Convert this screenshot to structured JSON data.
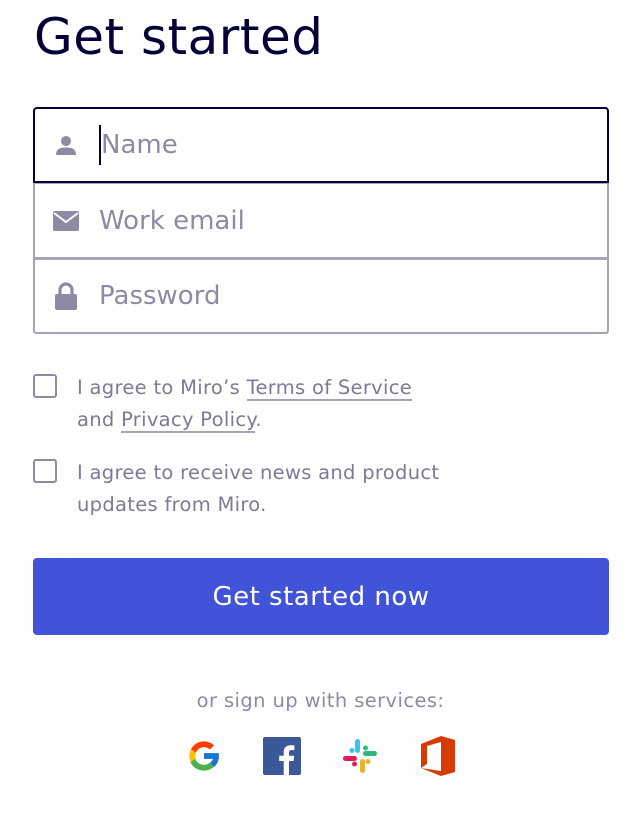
{
  "page": {
    "title": "Get started"
  },
  "form": {
    "name": {
      "placeholder": "Name",
      "icon": "person-icon"
    },
    "email": {
      "placeholder": "Work email",
      "icon": "envelope-icon"
    },
    "password": {
      "placeholder": "Password",
      "icon": "lock-icon"
    }
  },
  "consent": {
    "terms": {
      "prefix": "I agree to Miro’s ",
      "terms_link": "Terms of Service",
      "middle": "and ",
      "privacy_link": "Privacy Policy",
      "suffix": "."
    },
    "news": {
      "line1": "I agree to receive news and product",
      "line2": "updates from Miro."
    }
  },
  "cta": {
    "label": "Get started now",
    "color": "#4153d8"
  },
  "services": {
    "label": "or sign up with services:",
    "items": [
      "google-icon",
      "facebook-icon",
      "slack-icon",
      "office-icon"
    ]
  }
}
